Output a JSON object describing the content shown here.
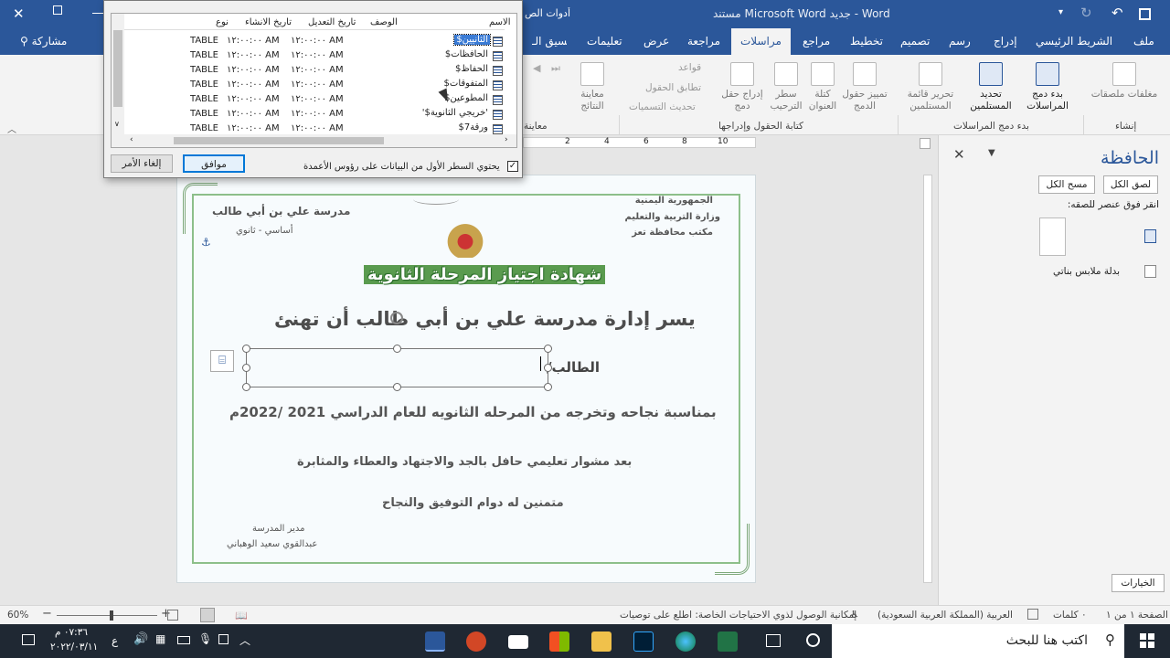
{
  "titlebar": {
    "title": "مستند Microsoft Word جديد - Word",
    "picture_tools": "أدوات الص"
  },
  "ribbon_tabs": [
    "ملف",
    "الشريط الرئيسي",
    "إدراج",
    "رسم",
    "تصميم",
    "تخطيط",
    "مراجع",
    "مراسلات",
    "مراجعة",
    "عرض",
    "تعليمات",
    "تنسيق الـ"
  ],
  "share": "مشاركة",
  "ribbon": {
    "create": {
      "envelopes_labels": "مغلفات ملصقات",
      "group": "إنشاء"
    },
    "start": {
      "start_merge": "بدء دمج المراسلات",
      "select_recipients": "تحديد المستلمين",
      "edit_list": "تحرير قائمة المستلمين",
      "group": "بدء دمج المراسلات"
    },
    "fields": {
      "highlight": "تمييز حقول الدمج",
      "address_block": "كتلة العنوان",
      "greeting_line": "سطر الترحيب",
      "insert_field": "إدراج حقل دمج",
      "rules": "قواعد",
      "match_fields": "تطابق الحقول",
      "update_labels": "تحديث التسميات",
      "group": "كتابة الحقول وإدراجها"
    },
    "preview": {
      "preview_results": "معاينة النتائج",
      "group": "معاينة"
    }
  },
  "dialog": {
    "headers": {
      "name": "الاسم",
      "description": "الوصف",
      "modified": "تاريخ التعديل",
      "created": "تاريخ الانشاء",
      "type": "نوع"
    },
    "rows": [
      {
        "name": "الثانيين$",
        "modified": "١٢:٠٠:٠٠ AM",
        "created": "١٢:٠٠:٠٠ AM",
        "type": "TABLE",
        "selected": true
      },
      {
        "name": "الحافظات$",
        "modified": "١٢:٠٠:٠٠ AM",
        "created": "١٢:٠٠:٠٠ AM",
        "type": "TABLE",
        "selected": false
      },
      {
        "name": "الحفاظ$",
        "modified": "١٢:٠٠:٠٠ AM",
        "created": "١٢:٠٠:٠٠ AM",
        "type": "TABLE",
        "selected": false
      },
      {
        "name": "المتفوقات$",
        "modified": "١٢:٠٠:٠٠ AM",
        "created": "١٢:٠٠:٠٠ AM",
        "type": "TABLE",
        "selected": false
      },
      {
        "name": "المطوعين$",
        "modified": "١٢:٠٠:٠٠ AM",
        "created": "١٢:٠٠:٠٠ AM",
        "type": "TABLE",
        "selected": false
      },
      {
        "name": "'خريجي الثانوية$'",
        "modified": "١٢:٠٠:٠٠ AM",
        "created": "١٢:٠٠:٠٠ AM",
        "type": "TABLE",
        "selected": false
      },
      {
        "name": "ورقة7$",
        "modified": "١٢:٠٠:٠٠ AM",
        "created": "١٢:٠٠:٠٠ AM",
        "type": "TABLE",
        "selected": false
      }
    ],
    "first_row_headers": "يحتوي السطر الأول من البيانات على رؤوس الأعمدة",
    "ok": "موافق",
    "cancel": "إلغاء الأمر"
  },
  "ruler_numbers": [
    "2",
    "4",
    "6",
    "8",
    "10"
  ],
  "certificate": {
    "republic": "الجمهورية اليمنية",
    "ministry": "وزارة التربية والتعليم",
    "office": "مكتب محافظة تعز",
    "school": "مدرسة علي بن أبي طالب",
    "stage": "أساسي - ثانوي",
    "title": "شهادة اجتياز المرحلة الثانوية",
    "line1": "يسر إدارة مدرسة علي بن أبي طالب أن تهنئ",
    "student_label": "الطالب/",
    "line2": "بمناسبة نجاحه وتخرجه من المرحله الثانويه للعام الدراسي 2021 /2022م",
    "line3": "بعد مشوار تعليمي حافل بالجد والاجتهاد والعطاء والمثابرة",
    "line4": "متمنين له دوام التوفيق والنجاح",
    "principal_title": "مدير المدرسة",
    "principal_name": "عبدالقوي سعيد الوهباني"
  },
  "clipboard": {
    "title": "الحافظة",
    "paste_all": "لصق الكل",
    "clear_all": "مسح الكل",
    "hint": "انقر فوق عنصر للصقه:",
    "item": "بدلة ملابس بناتي",
    "options": "الخيارات"
  },
  "status": {
    "page": "الصفحة ١ من ١",
    "words": "٠ كلمات",
    "language": "العربية (المملكة العربية السعودية)",
    "accessibility": "إمكانية الوصول لذوي الاحتياجات الخاصة: اطلع على توصيات",
    "zoom": "60%"
  },
  "taskbar": {
    "search": "اكتب هنا للبحث",
    "time": "٠٧:٣٦ م",
    "date": "٢٠٢٢/٠٣/١١",
    "lang": "ع"
  },
  "colors": {
    "word_blue": "#2b579a",
    "selection": "#3a7bd5",
    "cert_green": "#8dbf8a"
  }
}
